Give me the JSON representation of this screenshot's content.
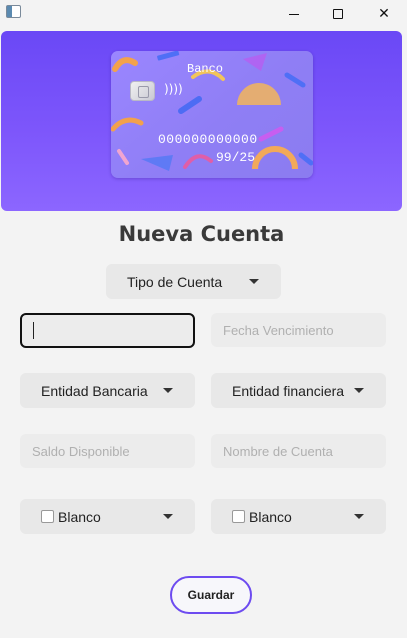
{
  "window": {
    "minimize_icon": "minimize-icon",
    "maximize_icon": "maximize-icon",
    "close_icon": "close-icon",
    "close_glyph": "✕"
  },
  "card": {
    "bank_name": "Banco",
    "contactless_glyph": "))))",
    "number": "000000000000",
    "expiry": "99/25",
    "gradient": [
      "#6a48f6",
      "#8c66ff"
    ]
  },
  "title": "Nueva Cuenta",
  "form": {
    "account_type": {
      "selected": "Tipo de Cuenta"
    },
    "number_field": {
      "value": "",
      "placeholder": ""
    },
    "expiry_field": {
      "value": "",
      "placeholder": "Fecha Vencimiento"
    },
    "bank_entity": {
      "selected": "Entidad Bancaria"
    },
    "financial_entity": {
      "selected": "Entidad financiera"
    },
    "balance_field": {
      "value": "",
      "placeholder": "Saldo Disponible"
    },
    "account_name_field": {
      "value": "",
      "placeholder": "Nombre de Cuenta"
    },
    "color_left": {
      "selected": "Blanco",
      "swatch": "#ffffff"
    },
    "color_right": {
      "selected": "Blanco",
      "swatch": "#ffffff"
    }
  },
  "save_label": "Guardar",
  "accent_color": "#6d4bf0"
}
